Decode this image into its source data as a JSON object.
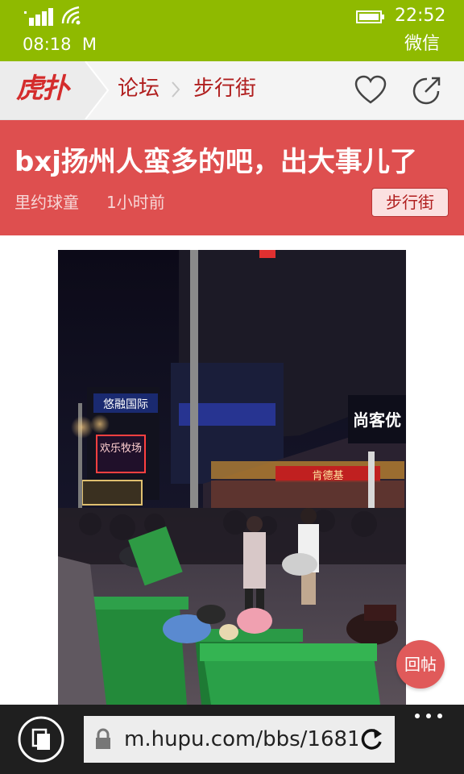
{
  "status_bar": {
    "clock": "22:52",
    "time": "08:18",
    "carrier_letter": "M",
    "app_name": "微信",
    "icons": [
      "signal-icon",
      "wifi-icon",
      "battery-icon"
    ]
  },
  "nav": {
    "logo": "虎扑",
    "breadcrumb": [
      "论坛",
      "步行街"
    ],
    "icons": [
      "heart-icon",
      "share-icon",
      "chevron-right-icon"
    ]
  },
  "post": {
    "title": "bxj扬州人蛮多的吧，出大事儿了",
    "author": "里约球童",
    "time": "1小时前",
    "board_tag": "步行街",
    "photo_signs": [
      "悠融国际",
      "欢乐牧场",
      "尚客优",
      "肯德基"
    ]
  },
  "reply_button": "回帖",
  "browser": {
    "url": "m.hupu.com/bbs/1681",
    "icons": [
      "tabs-icon",
      "lock-icon",
      "refresh-icon",
      "more-icon"
    ]
  },
  "colors": {
    "status_bar": "#8fba00",
    "banner": "#de4f4f",
    "accent": "#b01e1e",
    "browser_bar": "#1f1f1f"
  }
}
